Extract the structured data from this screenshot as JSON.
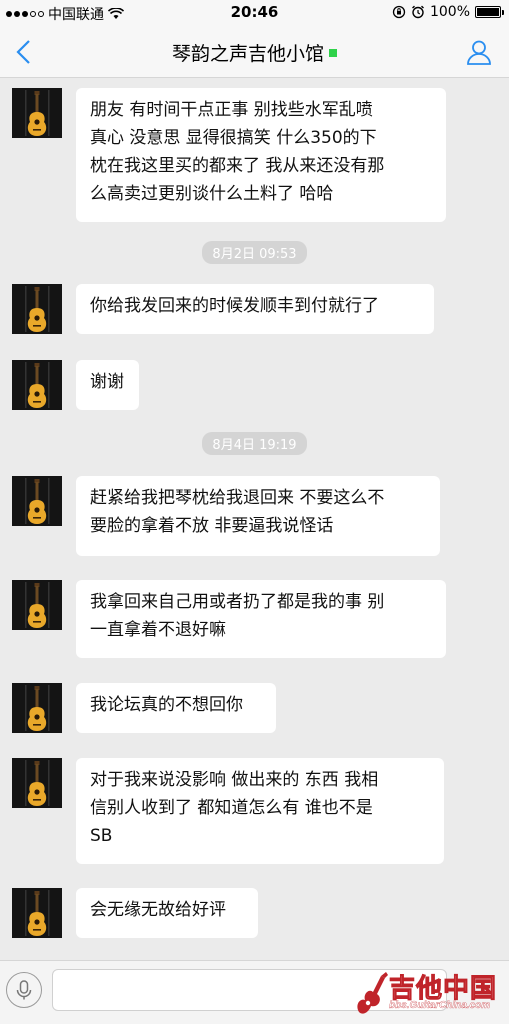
{
  "status_bar": {
    "carrier": "中国联通",
    "time": "20:46",
    "battery": "100%",
    "battery_level": 1.0
  },
  "nav": {
    "title": "琴韵之声吉他小馆",
    "online_color": "#2fd24a",
    "back_icon": "chevron-left-icon",
    "profile_icon": "person-icon"
  },
  "messages": [
    {
      "type": "text",
      "text": "朋友 有时间干点正事  别找些水军乱喷\n真心 没意思 显得很搞笑     什么350的下\n枕在我这里买的都来了  我从来还没有那\n么高卖过更别谈什么土料了  哈哈"
    },
    {
      "type": "time",
      "text": "8月2日 09:53"
    },
    {
      "type": "text",
      "text": "你给我发回来的时候发顺丰到付就行了"
    },
    {
      "type": "text",
      "text": "谢谢"
    },
    {
      "type": "time",
      "text": "8月4日 19:19"
    },
    {
      "type": "text",
      "text": "赶紧给我把琴枕给我退回来 不要这么不\n要脸的拿着不放  非要逼我说怪话"
    },
    {
      "type": "text",
      "text": "我拿回来自己用或者扔了都是我的事  别\n一直拿着不退好嘛"
    },
    {
      "type": "text",
      "text": "我论坛真的不想回你"
    },
    {
      "type": "text",
      "text": "对于我来说没影响  做出来的  东西 我相\n信别人收到了 都知道怎么有 谁也不是\nSB"
    },
    {
      "type": "text",
      "text": "会无缘无故给好评"
    }
  ],
  "input": {
    "value": "",
    "voice_icon": "microphone-icon"
  },
  "watermark": {
    "title": "吉他中国",
    "subtitle": "bbs.GuitarChina.com"
  },
  "colors": {
    "accent": "#2a8ef0",
    "background": "#ebebeb",
    "bubble": "#ffffff",
    "watermark_red": "#c0242a"
  }
}
